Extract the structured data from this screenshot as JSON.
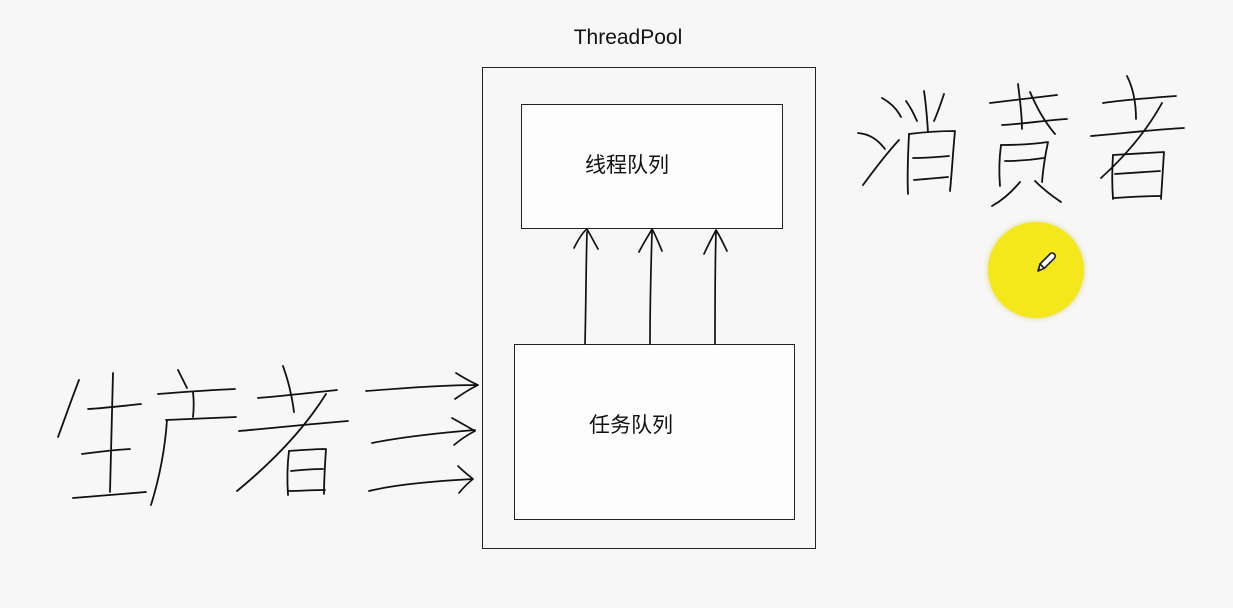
{
  "diagram": {
    "pool_title": "ThreadPool",
    "thread_queue_label": "线程队列",
    "task_queue_label": "任务队列"
  },
  "annotations": {
    "consumer_handwriting": "消费者",
    "producer_handwriting": "生产者",
    "cursor_icon": "pencil-icon"
  },
  "colors": {
    "background": "#f7f7f7",
    "ink": "#111111",
    "cursor_marker": "#f4e81c"
  }
}
